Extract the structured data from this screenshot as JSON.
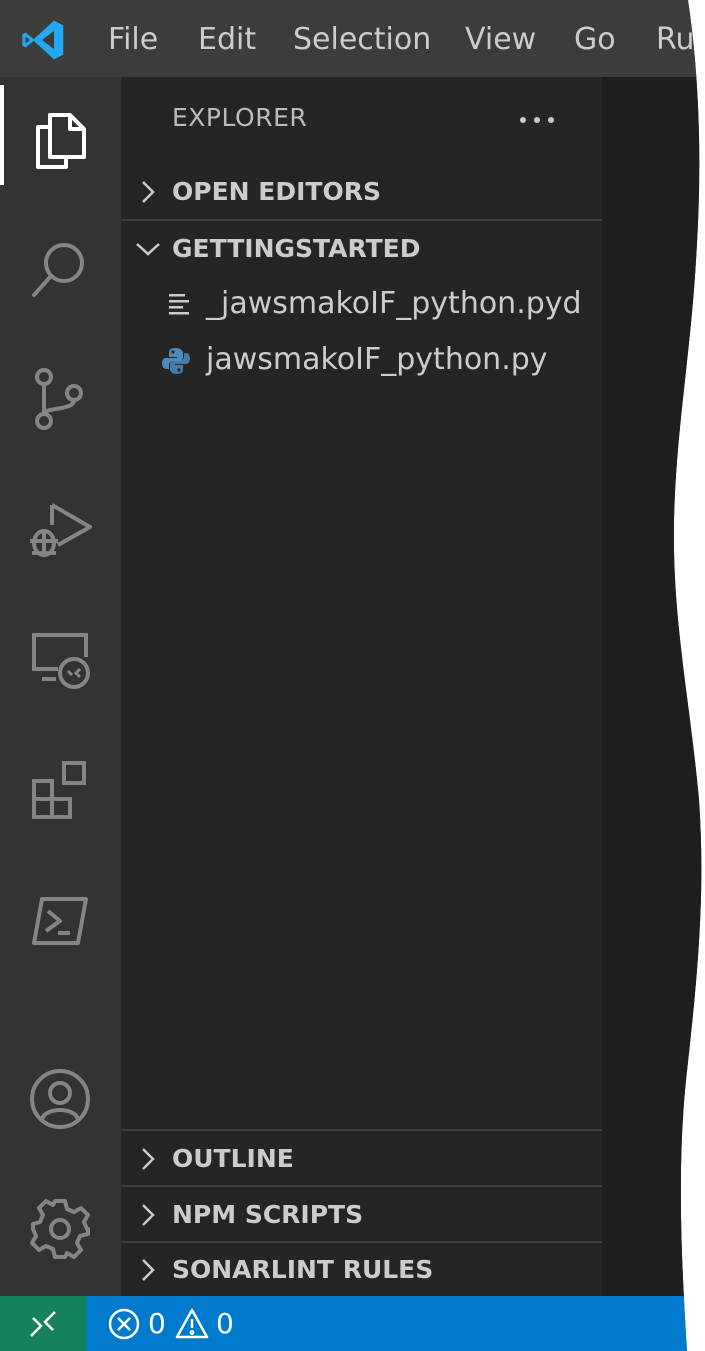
{
  "menubar": {
    "items": [
      "File",
      "Edit",
      "Selection",
      "View",
      "Go",
      "Ru"
    ]
  },
  "activity_bar": {
    "items": [
      "explorer",
      "search",
      "source-control",
      "run-and-debug",
      "remote-explorer",
      "extensions",
      "powershell",
      "accounts",
      "manage"
    ],
    "active": "explorer"
  },
  "sidebar": {
    "title": "EXPLORER",
    "sections": {
      "open_editors": "OPEN EDITORS",
      "folder": "GETTINGSTARTED",
      "outline": "OUTLINE",
      "npm_scripts": "NPM SCRIPTS",
      "sonarlint_rules": "SONARLINT RULES"
    },
    "files": [
      {
        "name": "_jawsmakoIF_python.pyd",
        "icon": "text-file-icon"
      },
      {
        "name": "jawsmakoIF_python.py",
        "icon": "python-icon"
      }
    ]
  },
  "statusbar": {
    "errors": "0",
    "warnings": "0"
  },
  "colors": {
    "menubar": "#3c3c3c",
    "activity_bar": "#333333",
    "sidebar": "#252526",
    "editor": "#1e1e1e",
    "statusbar": "#007acc",
    "remote": "#16825d",
    "vscode_blue": "#23a9f2",
    "python_blue": "#4b8bbe"
  }
}
